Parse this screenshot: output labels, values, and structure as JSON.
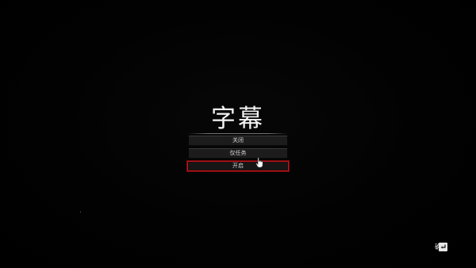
{
  "screen": {
    "title": "字幕",
    "options": [
      {
        "label": "关闭",
        "selected": false
      },
      {
        "label": "仅任务",
        "selected": false
      },
      {
        "label": "开启",
        "selected": true
      }
    ],
    "footer": {
      "confirm_label": "确定",
      "confirm_icon": "enter-key-icon"
    },
    "cursor_icon": "hand-pointer-icon"
  },
  "colors": {
    "background": "#000000",
    "selection_border": "#c4161c",
    "text": "#f2f2f2"
  }
}
